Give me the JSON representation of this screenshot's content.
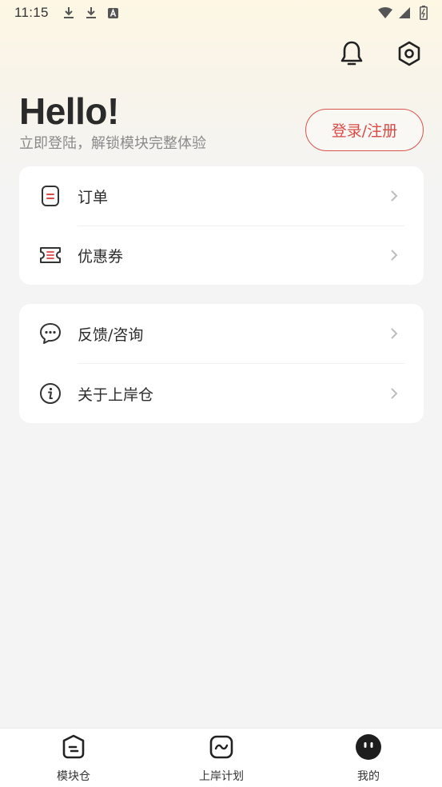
{
  "status_bar": {
    "time": "11:15",
    "left_icons": [
      "download-icon",
      "download-icon",
      "text-a-icon"
    ],
    "right_icons": [
      "wifi-icon",
      "signal-icon",
      "battery-icon"
    ]
  },
  "header": {
    "actions": [
      "bell-icon",
      "settings-hexagon-icon"
    ]
  },
  "profile": {
    "greeting": "Hello!",
    "subtitle": "立即登陆，解锁模块完整体验",
    "login_label": "登录/注册"
  },
  "menu_group_1": [
    {
      "label": "订单",
      "icon": "order-document-icon"
    },
    {
      "label": "优惠券",
      "icon": "coupon-ticket-icon"
    }
  ],
  "menu_group_2": [
    {
      "label": "反馈/咨询",
      "icon": "chat-bubble-icon"
    },
    {
      "label": "关于上岸仓",
      "icon": "info-circle-icon"
    }
  ],
  "tabbar": {
    "tabs": [
      {
        "label": "模块仓",
        "icon": "module-face-icon",
        "active": false
      },
      {
        "label": "上岸计划",
        "icon": "plan-wave-icon",
        "active": false
      },
      {
        "label": "我的",
        "icon": "me-face-icon",
        "active": true
      }
    ]
  },
  "colors": {
    "accent_red": "#d94a45",
    "background": "#f4f4f4",
    "card": "#ffffff"
  }
}
